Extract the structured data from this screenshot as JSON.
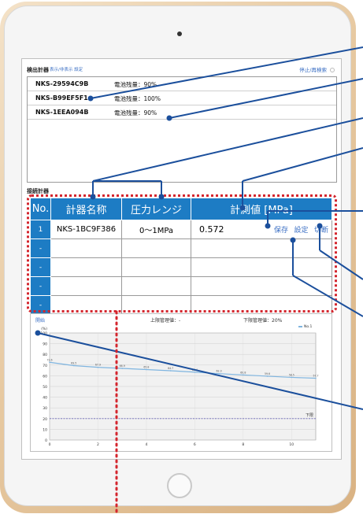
{
  "detect": {
    "title": "検出計器",
    "links": "表示/非表示 設定",
    "stop_button": "停止/再検索",
    "devices": [
      {
        "id": "NKS-29594C9B",
        "battery": "電池残量：90%"
      },
      {
        "id": "NKS-B99EF5F1",
        "battery": "電池残量：100%"
      },
      {
        "id": "NKS-1EEA094B",
        "battery": "電池残量：90%"
      }
    ]
  },
  "connected": {
    "title": "接続計器",
    "headers": {
      "no": "No.",
      "name": "計器名称",
      "range": "圧力レンジ",
      "value": "計測値 [MPa]"
    },
    "rows": [
      {
        "no": "1",
        "name": "NKS-1BC9F386",
        "range": "0～1MPa",
        "value": "0.572",
        "save": "保存",
        "settings": "設定",
        "disconnect": "切断"
      },
      {
        "no": "-",
        "name": "",
        "range": "",
        "value": ""
      },
      {
        "no": "-",
        "name": "",
        "range": "",
        "value": ""
      },
      {
        "no": "-",
        "name": "",
        "range": "",
        "value": ""
      },
      {
        "no": "-",
        "name": "",
        "range": "",
        "value": ""
      }
    ]
  },
  "graph": {
    "start_button": "開始",
    "upper_limit": "上限管理値：-",
    "lower_limit": "下限管理値：20%",
    "legend": "No.1",
    "lower_label": "下限",
    "unit": "(%)",
    "chart_data": {
      "type": "line",
      "x": [
        0,
        1,
        2,
        3,
        4,
        5,
        6,
        7,
        8,
        9,
        10,
        11
      ],
      "series": [
        {
          "name": "No.1",
          "values": [
            72.6,
            69.5,
            67.9,
            66.9,
            65.8,
            64.7,
            63.4,
            62.0,
            60.8,
            59.6,
            58.5,
            57.7
          ]
        }
      ],
      "data_labels": [
        "72.6",
        "69.5",
        "67.9",
        "66.9",
        "65.8",
        "64.7",
        "63.4",
        "62.0",
        "60.8",
        "59.6",
        "58.5",
        "57.7"
      ],
      "y_ticks": [
        "100",
        "90",
        "80",
        "70",
        "60",
        "50",
        "40",
        "30",
        "20",
        "10",
        "0"
      ],
      "x_ticks": [
        "0",
        "2",
        "4",
        "6",
        "8",
        "10"
      ],
      "lower_limit_value": 20,
      "xlim": [
        0,
        11
      ],
      "ylim": [
        0,
        100
      ]
    }
  },
  "colors": {
    "header_blue": "#1d7cc4",
    "link_blue": "#3b6fc4",
    "highlight_red": "#d4262e",
    "line_blue": "#7fb5e0",
    "limit_dash": "#6b67b8",
    "callout": "#1b4f9c"
  }
}
